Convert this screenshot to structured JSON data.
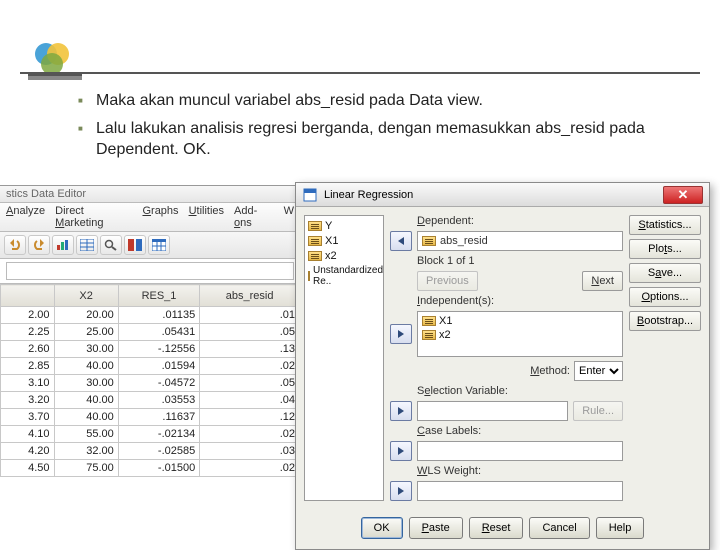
{
  "slide": {
    "bullets": [
      "Maka akan muncul variabel abs_resid pada Data view.",
      "Lalu lakukan analisis regresi berganda, dengan  memasukkan abs_resid pada Dependent. OK."
    ]
  },
  "editor": {
    "title_fragment": "stics Data Editor",
    "menu": [
      "Analyze",
      "Direct Marketing",
      "Graphs",
      "Utilities",
      "Add-ons",
      "W"
    ],
    "columns": [
      "",
      "X2",
      "RES_1",
      "abs_resid"
    ],
    "rows": [
      [
        "2.00",
        "20.00",
        ".01135",
        ".01"
      ],
      [
        "2.25",
        "25.00",
        ".05431",
        ".05"
      ],
      [
        "2.60",
        "30.00",
        "-.12556",
        ".13"
      ],
      [
        "2.85",
        "40.00",
        ".01594",
        ".02"
      ],
      [
        "3.10",
        "30.00",
        "-.04572",
        ".05"
      ],
      [
        "3.20",
        "40.00",
        ".03553",
        ".04"
      ],
      [
        "3.70",
        "40.00",
        ".11637",
        ".12"
      ],
      [
        "4.10",
        "55.00",
        "-.02134",
        ".02"
      ],
      [
        "4.20",
        "32.00",
        "-.02585",
        ".03"
      ],
      [
        "4.50",
        "75.00",
        "-.01500",
        ".02"
      ]
    ]
  },
  "dialog": {
    "title": "Linear Regression",
    "source_vars": [
      "Y",
      "X1",
      "x2",
      "Unstandardized Re.."
    ],
    "dependent_label": "Dependent:",
    "dependent_value": "abs_resid",
    "block_label": "Block 1 of 1",
    "prev": "Previous",
    "next": "Next",
    "independent_label": "Independent(s):",
    "independents": [
      "X1",
      "x2"
    ],
    "method_label": "Method:",
    "method_value": "Enter",
    "selvar_label": "Selection Variable:",
    "rule": "Rule...",
    "caselbl_label": "Case Labels:",
    "wls_label": "WLS Weight:",
    "right": [
      "Statistics...",
      "Plots...",
      "Save...",
      "Options...",
      "Bootstrap..."
    ],
    "buttons": {
      "ok": "OK",
      "paste": "Paste",
      "reset": "Reset",
      "cancel": "Cancel",
      "help": "Help"
    }
  }
}
